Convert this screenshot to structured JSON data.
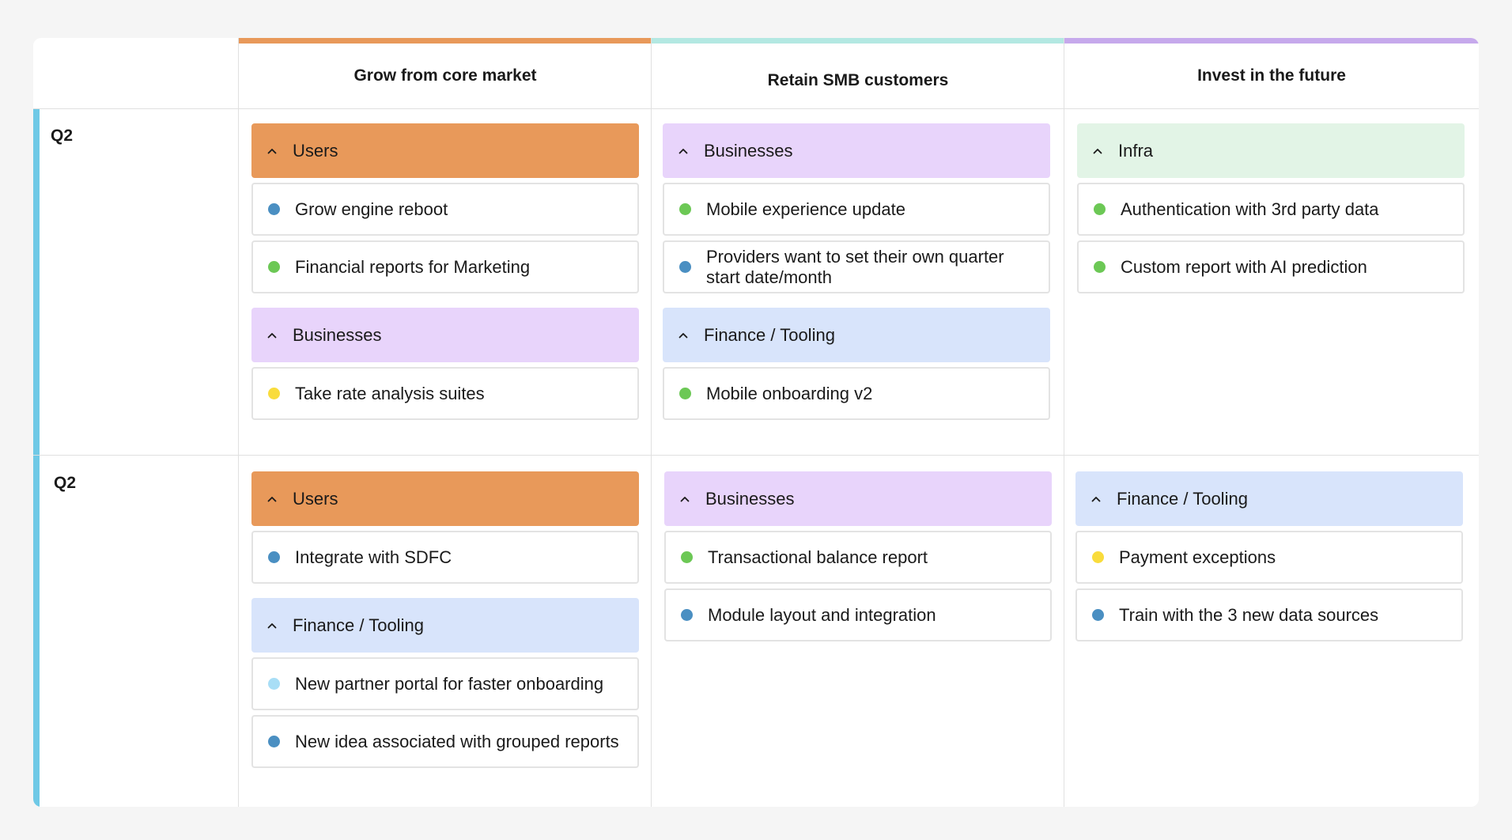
{
  "colors": {
    "strip_core": "#e8995a",
    "strip_smb": "#b3e8e2",
    "strip_future": "#c6a9ec",
    "row_strip": "#6fc9e6",
    "users": "#e8995a",
    "businesses": "#e8d4fb",
    "finance": "#d8e4fb",
    "infra": "#e2f4e6",
    "dot_blue": "#4a8fc2",
    "dot_green": "#6cc855",
    "dot_yellow": "#f9dc3c",
    "dot_lightblue": "#a8def6"
  },
  "columns": [
    {
      "title": "Grow from core market"
    },
    {
      "title": "Retain SMB customers"
    },
    {
      "title": "Invest in the future"
    }
  ],
  "rows": [
    {
      "label": "Q2",
      "cells": [
        {
          "groups": [
            {
              "title": "Users",
              "color": "users",
              "items": [
                {
                  "text": "Grow engine reboot",
                  "dot": "dot_blue"
                },
                {
                  "text": "Financial reports for Marketing",
                  "dot": "dot_green"
                }
              ]
            },
            {
              "title": "Businesses",
              "color": "businesses",
              "items": [
                {
                  "text": "Take rate analysis suites",
                  "dot": "dot_yellow"
                }
              ]
            }
          ]
        },
        {
          "groups": [
            {
              "title": "Businesses",
              "color": "businesses",
              "items": [
                {
                  "text": "Mobile experience update",
                  "dot": "dot_green"
                },
                {
                  "text": "Providers want to set their own quarter start date/month",
                  "dot": "dot_blue"
                }
              ]
            },
            {
              "title": "Finance / Tooling",
              "color": "finance",
              "items": [
                {
                  "text": "Mobile onboarding v2",
                  "dot": "dot_green"
                }
              ]
            }
          ]
        },
        {
          "groups": [
            {
              "title": "Infra",
              "color": "infra",
              "items": [
                {
                  "text": "Authentication with 3rd party data",
                  "dot": "dot_green"
                },
                {
                  "text": "Custom report with AI prediction",
                  "dot": "dot_green"
                }
              ]
            }
          ]
        }
      ]
    },
    {
      "label": "Q2",
      "cells": [
        {
          "groups": [
            {
              "title": "Users",
              "color": "users",
              "items": [
                {
                  "text": "Integrate with SDFC",
                  "dot": "dot_blue"
                }
              ]
            },
            {
              "title": "Finance / Tooling",
              "color": "finance",
              "items": [
                {
                  "text": "New partner portal for faster onboarding",
                  "dot": "dot_lightblue"
                },
                {
                  "text": "New idea associated with grouped reports",
                  "dot": "dot_blue"
                }
              ]
            }
          ]
        },
        {
          "groups": [
            {
              "title": "Businesses",
              "color": "businesses",
              "items": [
                {
                  "text": "Transactional balance report",
                  "dot": "dot_green"
                },
                {
                  "text": "Module layout and integration",
                  "dot": "dot_blue"
                }
              ]
            }
          ]
        },
        {
          "groups": [
            {
              "title": "Finance / Tooling",
              "color": "finance",
              "items": [
                {
                  "text": "Payment exceptions",
                  "dot": "dot_yellow"
                },
                {
                  "text": "Train with the 3 new data sources",
                  "dot": "dot_blue"
                }
              ]
            }
          ]
        }
      ]
    }
  ]
}
